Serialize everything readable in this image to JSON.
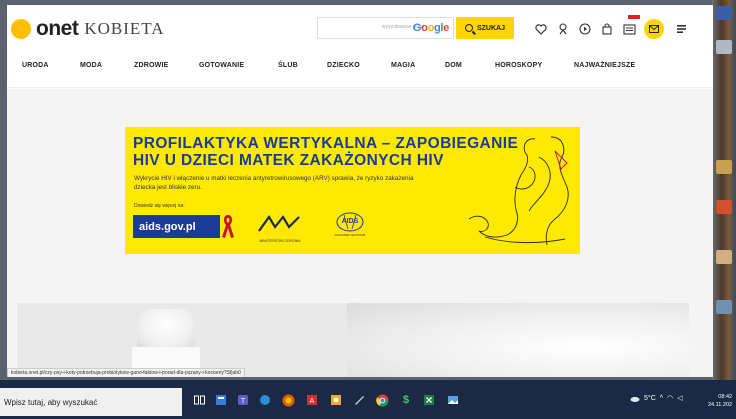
{
  "header": {
    "logo_brand": "onet",
    "logo_section": "KOBIETA",
    "search_placeholder": "wyszukiwane przez",
    "search_engine": "Google",
    "search_button": "SZUKAJ",
    "icons": [
      "heart-icon",
      "astrology-icon",
      "play-icon",
      "bag-icon",
      "newspaper-icon",
      "mail-icon",
      "menu-icon"
    ]
  },
  "nav": {
    "items": [
      "URODA",
      "MODA",
      "ZDROWIE",
      "GOTOWANIE",
      "ŚLUB",
      "DZIECKO",
      "MAGIA",
      "DOM",
      "HOROSKOPY",
      "NAJWAŻNIEJSZE"
    ]
  },
  "ad": {
    "title_line1": "PROFILAKTYKA WERTYKALNA – ZAPOBIEGANIE",
    "title_line2": "HIV U DZIECI MATEK ZAKAŻONYCH HIV",
    "subtitle": "Wykrycie HIV i włączenie u matki leczenia antyretrowirusowego (ARV) sprawia, że ryzyko zakażenia dziecka jest bliskie zeru.",
    "more_label": "Dowiedz się więcej na:",
    "url": "aids.gov.pl",
    "ministry_label": "MINISTERSTWO ZDROWIA",
    "aids_logo_text": "AIDS",
    "aids_logo_caption": "KRAJOWE CENTRUM",
    "colors": {
      "background": "#ffe900",
      "text": "#1a3c96"
    }
  },
  "status_bar": {
    "url": "kobieta.onet.pl/czy-psy-i-koty-potrzebuja-probiotykow-gano-faktow-i-porad-dla-pszany-i-kociarny?Sfjab0"
  },
  "taskbar": {
    "search_text": "Wpisz tutaj, aby wyszukać",
    "weather": "5°C",
    "time": "08:42",
    "date": "24.11.202"
  }
}
